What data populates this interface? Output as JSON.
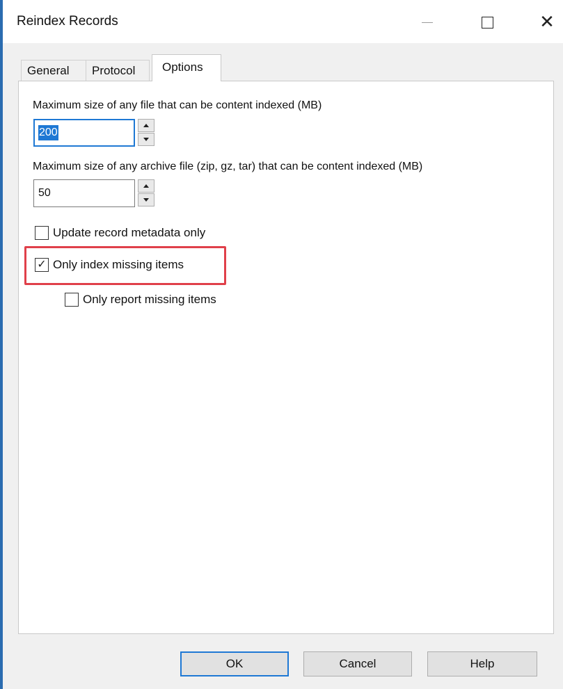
{
  "window": {
    "title": "Reindex Records"
  },
  "tabs": [
    {
      "label": "General",
      "active": false
    },
    {
      "label": "Protocol",
      "active": false
    },
    {
      "label": "Options",
      "active": true
    }
  ],
  "options": {
    "max_file_label": "Maximum size of any file that can be content indexed (MB)",
    "max_file_value": "200",
    "max_archive_label": "Maximum size of any archive file (zip, gz, tar) that can be content indexed (MB)",
    "max_archive_value": "50",
    "update_metadata_label": "Update record metadata only",
    "update_metadata_checked": false,
    "only_index_missing_label": "Only index missing items",
    "only_index_missing_checked": true,
    "only_report_missing_label": "Only report missing items",
    "only_report_missing_checked": false
  },
  "buttons": {
    "ok": "OK",
    "cancel": "Cancel",
    "help": "Help"
  },
  "colors": {
    "accent": "#1e78d4",
    "highlight": "#e0404a"
  },
  "glyphs": {
    "check": "✓",
    "close": "✕"
  }
}
